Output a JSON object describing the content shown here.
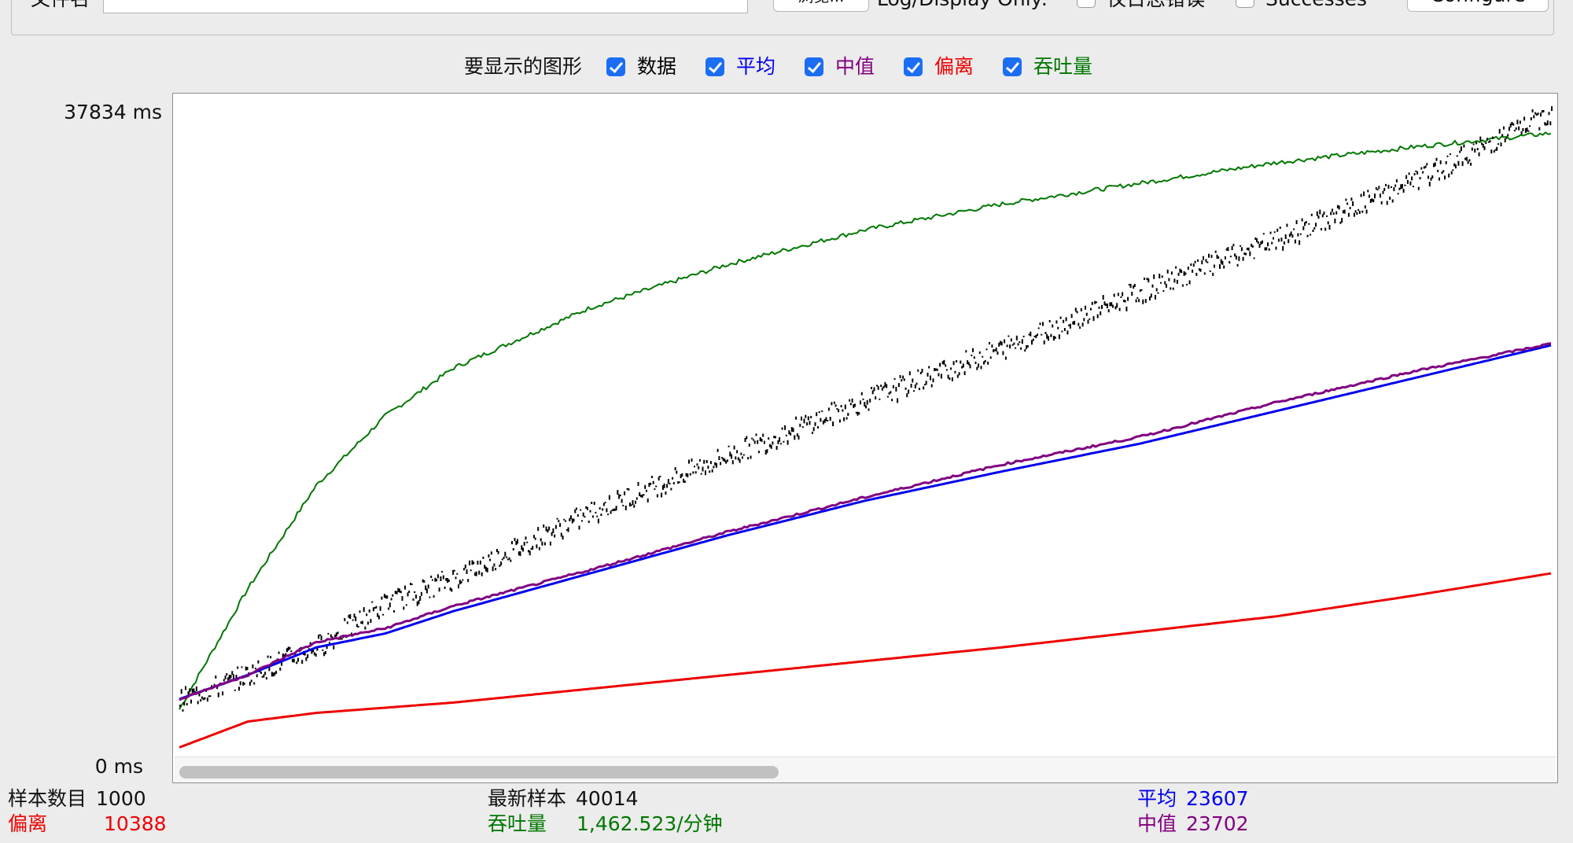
{
  "file_row": {
    "label": "文件名",
    "filename_value": "",
    "browse_label": "浏览...",
    "log_display_only_label": "Log/Display Only:",
    "errors_only_label": "仅日志错误",
    "errors_only_checked": false,
    "successes_label": "Successes",
    "successes_checked": false,
    "configure_label": "Configure"
  },
  "graphs_row": {
    "label": "要显示的图形",
    "items": [
      {
        "label": "数据",
        "checked": true,
        "color": "#000000"
      },
      {
        "label": "平均",
        "checked": true,
        "color": "#0000ee"
      },
      {
        "label": "中值",
        "checked": true,
        "color": "#800080"
      },
      {
        "label": "偏离",
        "checked": true,
        "color": "#ee0000"
      },
      {
        "label": "吞吐量",
        "checked": true,
        "color": "#007700"
      }
    ]
  },
  "chart_data": {
    "type": "line",
    "y_max_label": "37834  ms",
    "y_min_label": "0  ms",
    "ylim": [
      0,
      37834
    ],
    "x": [
      0,
      50,
      100,
      150,
      200,
      300,
      400,
      500,
      600,
      700,
      800,
      900,
      1000
    ],
    "series": [
      {
        "name": "数据",
        "color": "#000000",
        "style": "dots",
        "values": [
          3100,
          4600,
          6200,
          8700,
          10200,
          14000,
          17300,
          20500,
          23500,
          26800,
          29800,
          33200,
          37200
        ]
      },
      {
        "name": "平均",
        "color": "#0000ee",
        "style": "line",
        "values": [
          3100,
          4500,
          6100,
          6900,
          8200,
          10400,
          12600,
          14600,
          16300,
          17900,
          19800,
          21700,
          23607
        ]
      },
      {
        "name": "中值",
        "color": "#800080",
        "style": "line",
        "values": [
          3100,
          4500,
          6400,
          7200,
          8500,
          10600,
          12800,
          14800,
          16700,
          18300,
          20300,
          22100,
          23702
        ]
      },
      {
        "name": "偏离",
        "color": "#ee0000",
        "style": "line",
        "values": [
          300,
          1800,
          2300,
          2600,
          2900,
          3700,
          4500,
          5300,
          6100,
          7000,
          7900,
          9100,
          10388
        ]
      },
      {
        "name": "吞吐量",
        "color": "#007700",
        "style": "line",
        "values": [
          2500,
          9500,
          15500,
          19500,
          22300,
          25800,
          28300,
          30300,
          31800,
          33000,
          34200,
          35100,
          35900
        ]
      }
    ],
    "grid": false
  },
  "stats": {
    "samples_label": "样本数目",
    "samples_value": "1000",
    "latest_label": "最新样本",
    "latest_value": "40014",
    "average_label": "平均",
    "average_value": "23607",
    "deviation_label": "偏离",
    "deviation_value": "10388",
    "throughput_label": "吞吐量",
    "throughput_value": "1,462.523/分钟",
    "median_label": "中值",
    "median_value": "23702",
    "colors": {
      "deviation": "#ee0000",
      "throughput": "#007700",
      "average": "#0000ee",
      "median": "#800080"
    }
  }
}
